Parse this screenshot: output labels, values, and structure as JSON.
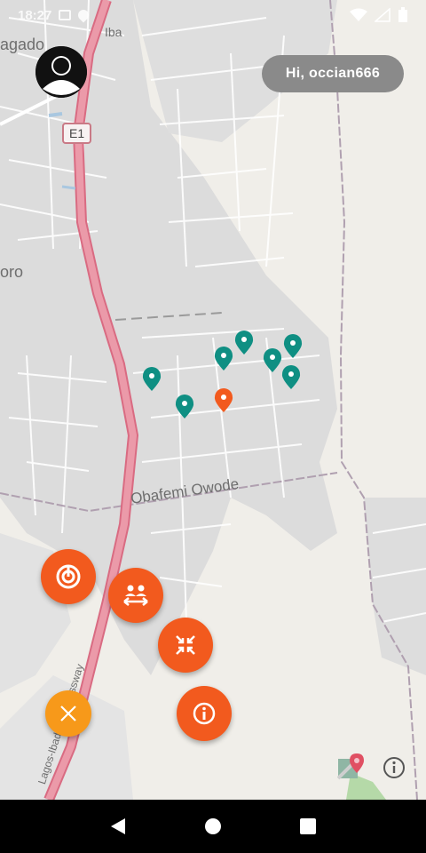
{
  "status_bar": {
    "time": "18:27"
  },
  "header": {
    "greeting": "Hi, occian666"
  },
  "map": {
    "labels": {
      "top_left": "agado",
      "top_ib": "Iba",
      "left_oro": "oro",
      "road_badge": "E1",
      "road_name": "Obafemi Owode",
      "highway": "Lagos-Ibadan Expressway"
    },
    "colors": {
      "highway": "#e8899a",
      "pin_teal": "#0f8f83",
      "pin_orange": "#f25a1e"
    },
    "pins": [
      {
        "color": "teal"
      },
      {
        "color": "teal"
      },
      {
        "color": "teal"
      },
      {
        "color": "teal"
      },
      {
        "color": "teal"
      },
      {
        "color": "teal"
      },
      {
        "color": "teal"
      },
      {
        "color": "orange"
      }
    ]
  },
  "fabs": [
    {
      "name": "location-target-button",
      "icon": "target-icon"
    },
    {
      "name": "distance-button",
      "icon": "group-arrows-icon"
    },
    {
      "name": "collapse-button",
      "icon": "collapse-icon"
    },
    {
      "name": "info-button",
      "icon": "info-icon"
    },
    {
      "name": "close-button",
      "icon": "close-icon"
    }
  ],
  "nav": [
    "back-icon",
    "home-icon",
    "recents-icon"
  ]
}
